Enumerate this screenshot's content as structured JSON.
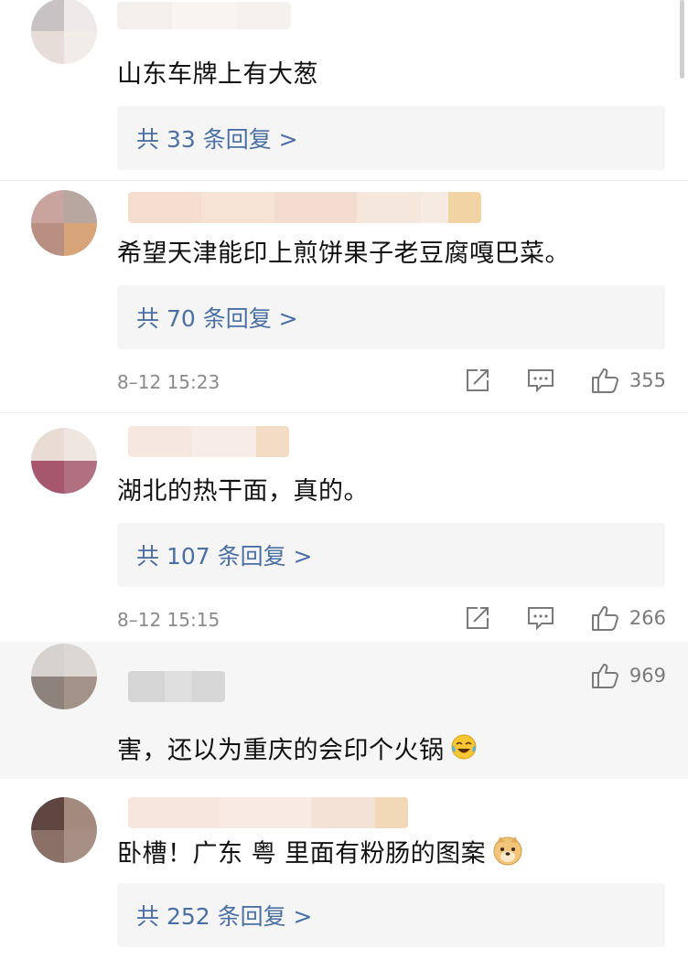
{
  "comments": [
    {
      "text": "山东车牌上有大葱",
      "replies": "共 33 条回复 >"
    },
    {
      "text": "希望天津能印上煎饼果子老豆腐嘎巴菜。",
      "replies": "共 70 条回复 >",
      "time": "8–12 15:23",
      "likes": "355"
    },
    {
      "text": "湖北的热干面，真的。",
      "replies": "共 107 条回复 >",
      "time": "8–12 15:15",
      "likes": "266"
    },
    {
      "text": "害，还以为重庆的会印个火锅",
      "likes": "969",
      "emoji": "laughing-tears-emoji"
    },
    {
      "text": "卧槽！广东 粤 里面有粉肠的图案",
      "replies": "共 252 条回复 >",
      "emoji": "doge-emoji"
    }
  ],
  "icons": {
    "share": "share-icon",
    "reply": "comment-icon",
    "like": "thumbs-up-icon"
  },
  "colors": {
    "link": "#4a6fa5",
    "muted": "#8a8a8a",
    "panel": "#f5f5f5"
  }
}
